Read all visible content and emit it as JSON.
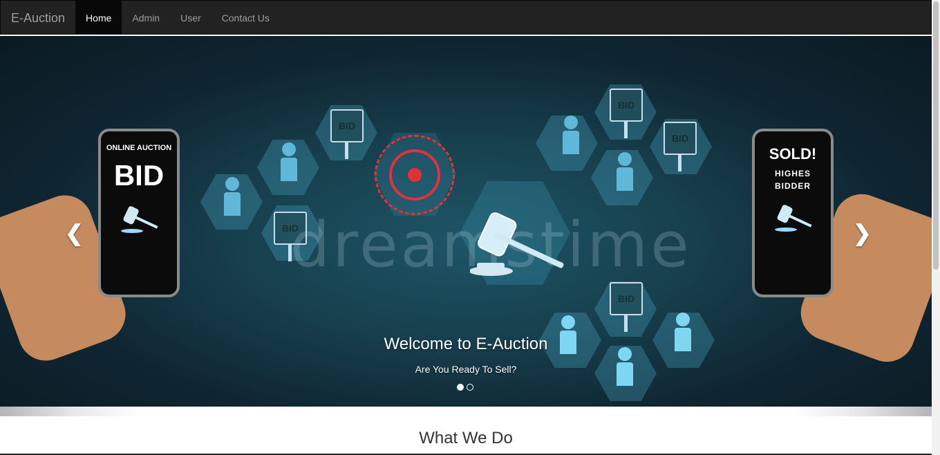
{
  "navbar": {
    "brand": "E-Auction",
    "items": [
      {
        "label": "Home",
        "active": true
      },
      {
        "label": "Admin",
        "active": false
      },
      {
        "label": "User",
        "active": false
      },
      {
        "label": "Contact Us",
        "active": false
      }
    ]
  },
  "carousel": {
    "caption_title": "Welcome to E-Auction",
    "caption_text": "Are You Ready To Sell?",
    "left_phone": {
      "line1": "ONLINE AUCTION",
      "line2": "BID"
    },
    "right_phone": {
      "line1": "SOLD!",
      "line2": "HIGHES",
      "line3": "BIDDER"
    },
    "sign_text": "BID",
    "watermark": "dreamstime",
    "prev_icon": "chevron-left-icon",
    "next_icon": "chevron-right-icon",
    "indicators": [
      true,
      false
    ]
  },
  "section": {
    "title": "What We Do"
  },
  "colors": {
    "navbar": "#222222",
    "accent_red": "#e1323c",
    "hex_blue": "#5fb8d8"
  }
}
